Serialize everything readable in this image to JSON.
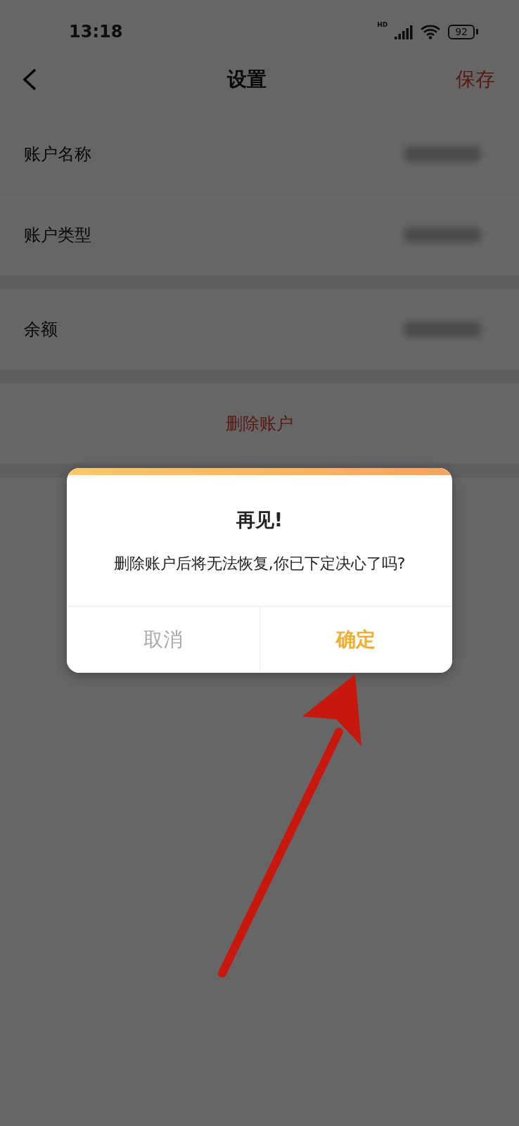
{
  "status_bar": {
    "time": "13:18",
    "network": "HD",
    "battery": "92"
  },
  "nav": {
    "title": "设置",
    "action": "保存"
  },
  "sections": [
    {
      "rows": [
        {
          "label": "账户名称",
          "value_hidden": true
        },
        {
          "label": "账户类型",
          "value_hidden": true
        }
      ]
    },
    {
      "rows": [
        {
          "label": "余额",
          "value_hidden": true
        }
      ]
    },
    {
      "rows": [
        {
          "kind": "danger",
          "label": "删除账户"
        }
      ]
    }
  ],
  "dialog": {
    "title": "再见!",
    "message": "删除账户后将无法恢复,你已下定决心了吗?",
    "buttons": [
      {
        "label": "取消",
        "kind": "cancel"
      },
      {
        "label": "确定",
        "kind": "confirm"
      }
    ]
  }
}
